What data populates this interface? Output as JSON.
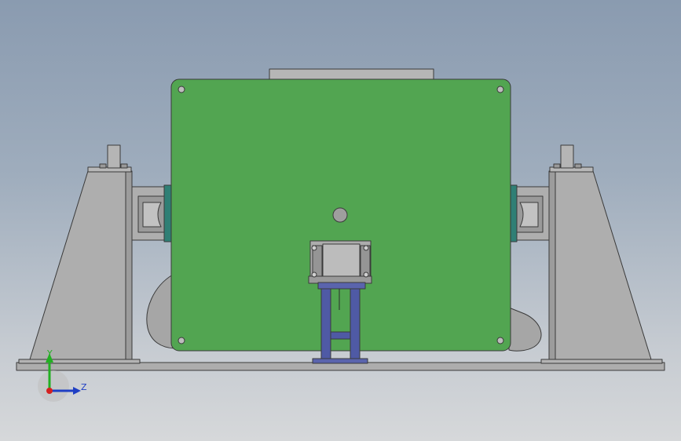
{
  "triad": {
    "y_label": "Y",
    "z_label": "Z"
  },
  "colors": {
    "panel": "#52a551",
    "steel": "#adadad",
    "steel_dark": "#8e8e8e",
    "stand": "#4f5aa5",
    "outline": "#3a3a3a",
    "axis_y": "#22b022",
    "axis_z": "#1f3fc4",
    "axis_x": "#d42020"
  }
}
